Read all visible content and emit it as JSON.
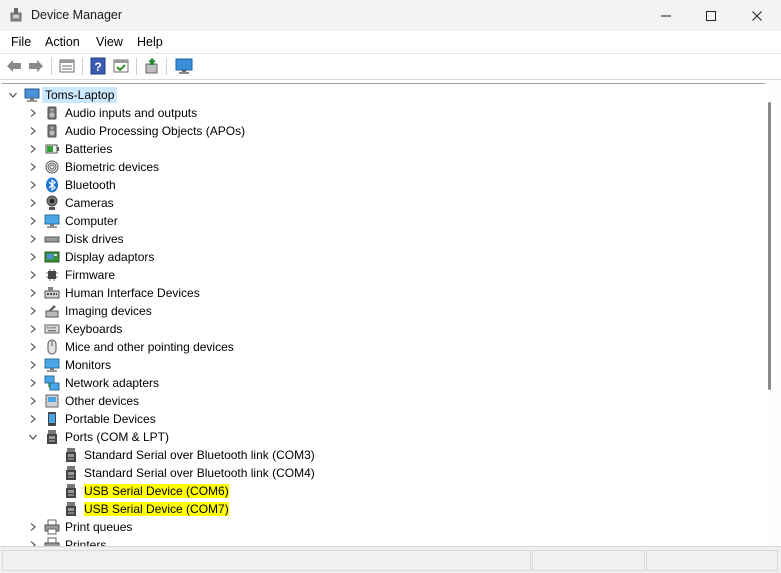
{
  "window": {
    "title": "Device Manager"
  },
  "menu": [
    {
      "label": "File"
    },
    {
      "label": "Action"
    },
    {
      "label": "View"
    },
    {
      "label": "Help"
    }
  ],
  "toolbar": {
    "buttons": [
      "back-arrow-icon",
      "forward-arrow-icon",
      "properties-icon",
      "help-icon",
      "show-hidden-icon",
      "scan-hardware-icon",
      "monitor-icon"
    ]
  },
  "tree": {
    "root": {
      "label": "Toms-Laptop",
      "icon": "computer-icon",
      "expanded": true
    },
    "categories": [
      {
        "label": "Audio inputs and outputs",
        "icon": "speaker-icon",
        "expanded": false
      },
      {
        "label": "Audio Processing Objects (APOs)",
        "icon": "speaker-icon",
        "expanded": false
      },
      {
        "label": "Batteries",
        "icon": "battery-icon",
        "expanded": false
      },
      {
        "label": "Biometric devices",
        "icon": "fingerprint-icon",
        "expanded": false
      },
      {
        "label": "Bluetooth",
        "icon": "bluetooth-icon",
        "expanded": false
      },
      {
        "label": "Cameras",
        "icon": "camera-icon",
        "expanded": false
      },
      {
        "label": "Computer",
        "icon": "monitor-icon",
        "expanded": false
      },
      {
        "label": "Disk drives",
        "icon": "disk-drive-icon",
        "expanded": false
      },
      {
        "label": "Display adaptors",
        "icon": "display-adapter-icon",
        "expanded": false
      },
      {
        "label": "Firmware",
        "icon": "chip-icon",
        "expanded": false
      },
      {
        "label": "Human Interface Devices",
        "icon": "hid-icon",
        "expanded": false
      },
      {
        "label": "Imaging devices",
        "icon": "imaging-icon",
        "expanded": false
      },
      {
        "label": "Keyboards",
        "icon": "keyboard-icon",
        "expanded": false
      },
      {
        "label": "Mice and other pointing devices",
        "icon": "mouse-icon",
        "expanded": false
      },
      {
        "label": "Monitors",
        "icon": "monitor-icon",
        "expanded": false
      },
      {
        "label": "Network adapters",
        "icon": "network-icon",
        "expanded": false
      },
      {
        "label": "Other devices",
        "icon": "other-device-icon",
        "expanded": false
      },
      {
        "label": "Portable Devices",
        "icon": "portable-device-icon",
        "expanded": false
      },
      {
        "label": "Ports (COM & LPT)",
        "icon": "port-icon",
        "expanded": true,
        "children": [
          {
            "label": "Standard Serial over Bluetooth link (COM3)",
            "icon": "port-icon",
            "highlighted": false
          },
          {
            "label": "Standard Serial over Bluetooth link (COM4)",
            "icon": "port-icon",
            "highlighted": false
          },
          {
            "label": "USB Serial Device (COM6)",
            "icon": "port-icon",
            "highlighted": true
          },
          {
            "label": "USB Serial Device (COM7)",
            "icon": "port-icon",
            "highlighted": true
          }
        ]
      },
      {
        "label": "Print queues",
        "icon": "printer-icon",
        "expanded": false
      },
      {
        "label": "Printers",
        "icon": "printer-icon",
        "expanded": false
      }
    ]
  },
  "colors": {
    "selection": "#cce8ff",
    "highlight": "#ffff00"
  }
}
